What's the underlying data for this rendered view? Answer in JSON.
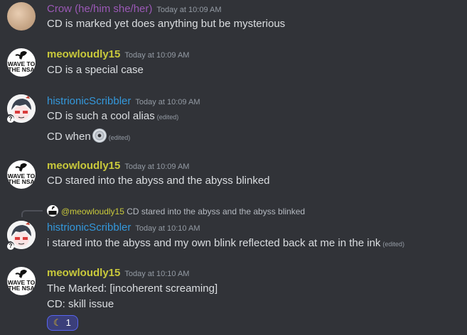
{
  "messages": [
    {
      "author": "Crow (he/him she/her)",
      "time": "Today at 10:09 AM",
      "lines": [
        {
          "text": "CD is marked yet does anything but be mysterious"
        }
      ]
    },
    {
      "author": "meowloudly15",
      "time": "Today at 10:09 AM",
      "lines": [
        {
          "text": "CD is a special case"
        }
      ]
    },
    {
      "author": "histrionicScribbler",
      "time": "Today at 10:09 AM",
      "lines": [
        {
          "text": "CD is such a cool alias",
          "edited": "(edited)"
        },
        {
          "text": "CD when",
          "emoji": "cd-disc-icon",
          "edited": "(edited)"
        }
      ]
    },
    {
      "author": "meowloudly15",
      "time": "Today at 10:09 AM",
      "lines": [
        {
          "text": "CD stared into the abyss and the abyss blinked"
        }
      ]
    },
    {
      "reply": {
        "mention": "@meowloudly15",
        "text": "CD stared into the abyss and the abyss blinked"
      },
      "author": "histrionicScribbler",
      "time": "Today at 10:10 AM",
      "lines": [
        {
          "text": "i stared into the abyss and my own blink reflected back at me in the ink",
          "edited": "(edited)"
        }
      ]
    },
    {
      "author": "meowloudly15",
      "time": "Today at 10:10 AM",
      "lines": [
        {
          "text": "The Marked: [incoherent screaming]"
        },
        {
          "text": "CD: skill issue"
        }
      ],
      "reaction": {
        "emoji": "crescent-moon-icon",
        "glyph": "☾",
        "count": "1"
      }
    }
  ],
  "avatar_text": {
    "nsa_line1": "WAVE TO",
    "nsa_line2": "THE NSA"
  },
  "colors": {
    "background": "#313338",
    "crow_name": "#9b59b6",
    "meow_name": "#c9c93b",
    "hist_name": "#3498db",
    "text": "#dbdee1",
    "muted": "#949ba4",
    "reaction_border": "#5865f2"
  }
}
